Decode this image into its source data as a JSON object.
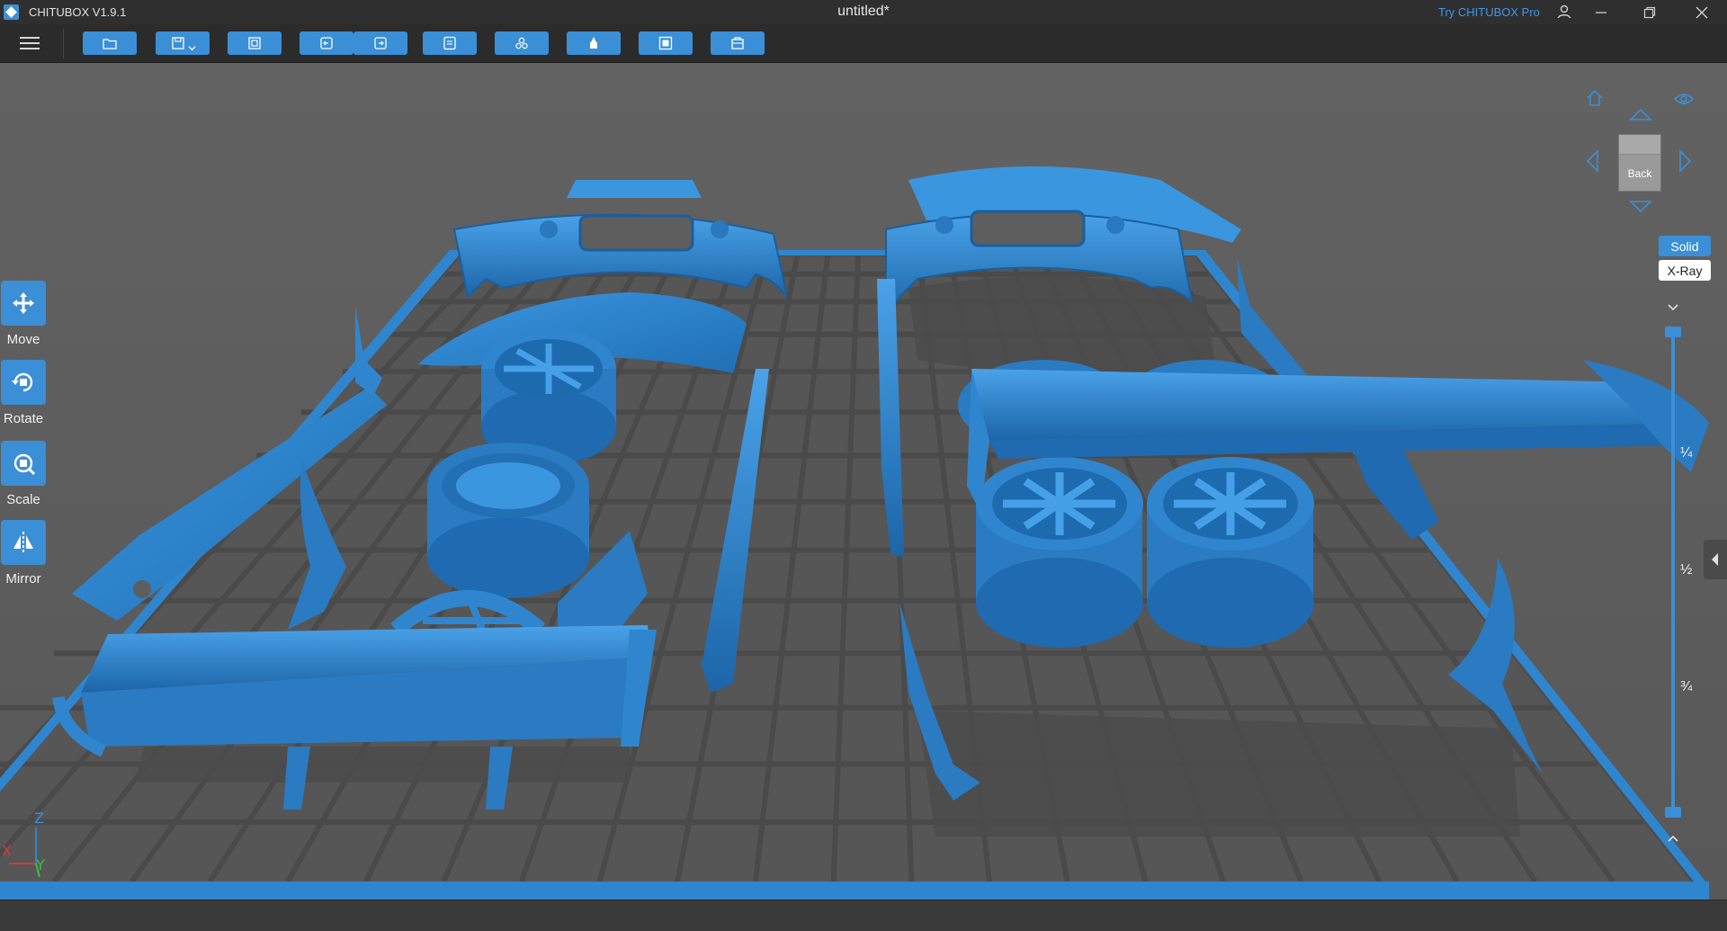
{
  "app": {
    "name": "CHITUBOX V1.9.1",
    "document_title": "untitled*",
    "pro_link": "Try CHITUBOX Pro"
  },
  "toolbar": {
    "buttons": [
      {
        "name": "open-file-button",
        "icon": "folder-icon"
      },
      {
        "name": "save-button",
        "icon": "save-icon"
      },
      {
        "name": "auto-layout-button",
        "icon": "layout-icon"
      },
      {
        "name": "undo-button",
        "icon": "undo-icon"
      },
      {
        "name": "redo-button",
        "icon": "redo-icon"
      },
      {
        "name": "settings-button",
        "icon": "settings-icon"
      },
      {
        "name": "multi-model-button",
        "icon": "models-icon"
      },
      {
        "name": "supports-button",
        "icon": "supports-icon"
      },
      {
        "name": "hollow-button",
        "icon": "hollow-icon"
      },
      {
        "name": "slice-button",
        "icon": "slice-icon"
      }
    ]
  },
  "tools": [
    {
      "id": "move",
      "label": "Move"
    },
    {
      "id": "rotate",
      "label": "Rotate"
    },
    {
      "id": "scale",
      "label": "Scale"
    },
    {
      "id": "mirror",
      "label": "Mirror"
    }
  ],
  "view_cube": {
    "face": "Back"
  },
  "render_modes": {
    "solid": "Solid",
    "xray": "X-Ray",
    "active": "Solid"
  },
  "layer_slider": {
    "ticks": [
      "¼",
      "½",
      "¾"
    ],
    "top_value_fraction": 1.0,
    "bottom_value_fraction": 0.0
  },
  "axes": {
    "x": "X",
    "y": "Y",
    "z": "Z"
  },
  "colors": {
    "accent": "#3b8fd6",
    "model": "#2f86cf",
    "background": "#5e5e5e",
    "plate": "#555555"
  }
}
